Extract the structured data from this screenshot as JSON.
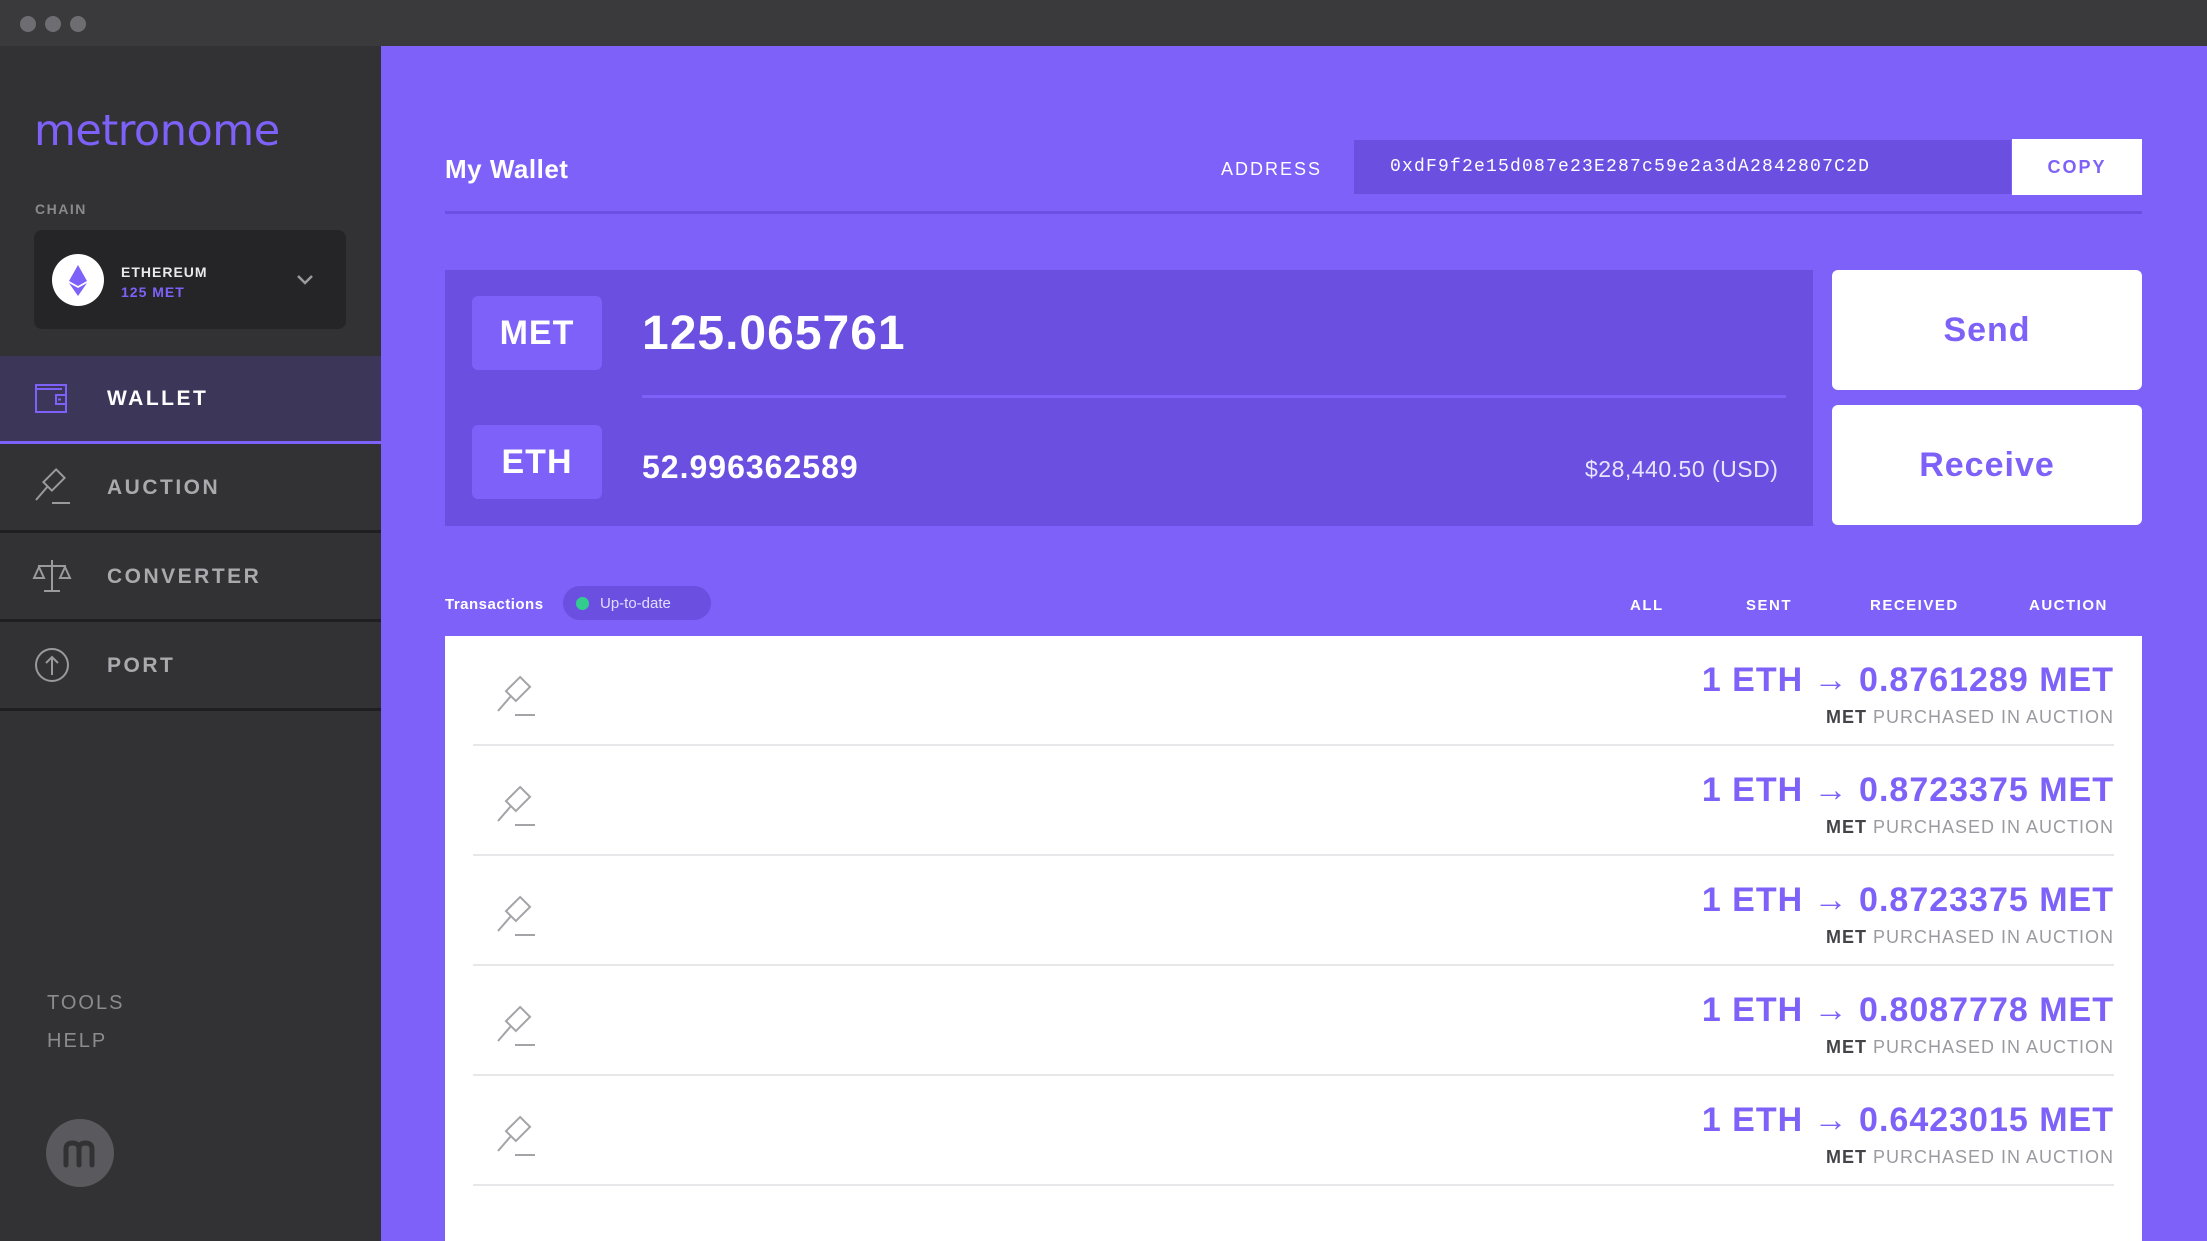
{
  "sidebar": {
    "logo": "metronome",
    "chain_label": "CHAIN",
    "chain": {
      "name": "ETHEREUM",
      "balance": "125 MET"
    },
    "nav": [
      {
        "label": "WALLET",
        "icon": "wallet-icon",
        "active": true
      },
      {
        "label": "AUCTION",
        "icon": "gavel-icon",
        "active": false
      },
      {
        "label": "CONVERTER",
        "icon": "scale-icon",
        "active": false
      },
      {
        "label": "PORT",
        "icon": "port-arrow-icon",
        "active": false
      }
    ],
    "links": [
      "TOOLS",
      "HELP"
    ],
    "avatar_letter": "m"
  },
  "header": {
    "title": "My Wallet",
    "address_label": "ADDRESS",
    "address": "0xdF9f2e15d087e23E287c59e2a3dA2842807C2D",
    "copy_label": "COPY"
  },
  "balances": {
    "met": {
      "symbol": "MET",
      "value": "125.065761"
    },
    "eth": {
      "symbol": "ETH",
      "value": "52.996362589",
      "usd": "$28,440.50 (USD)"
    }
  },
  "actions": {
    "send": "Send",
    "receive": "Receive"
  },
  "transactions": {
    "label": "Transactions",
    "status": "Up-to-date",
    "filters": [
      "ALL",
      "SENT",
      "RECEIVED",
      "AUCTION"
    ],
    "items": [
      {
        "amount": "1 ETH → 0.8761289 MET",
        "token": "MET",
        "desc": "PURCHASED IN AUCTION"
      },
      {
        "amount": "1 ETH → 0.8723375 MET",
        "token": "MET",
        "desc": "PURCHASED IN AUCTION"
      },
      {
        "amount": "1 ETH → 0.8723375 MET",
        "token": "MET",
        "desc": "PURCHASED IN AUCTION"
      },
      {
        "amount": "1 ETH → 0.8087778 MET",
        "token": "MET",
        "desc": "PURCHASED IN AUCTION"
      },
      {
        "amount": "1 ETH → 0.6423015 MET",
        "token": "MET",
        "desc": "PURCHASED IN AUCTION"
      }
    ]
  },
  "colors": {
    "accent": "#7e61f8",
    "panel": "#6a4fe0",
    "sidebar": "#323234",
    "status_ok": "#33cc8e"
  }
}
